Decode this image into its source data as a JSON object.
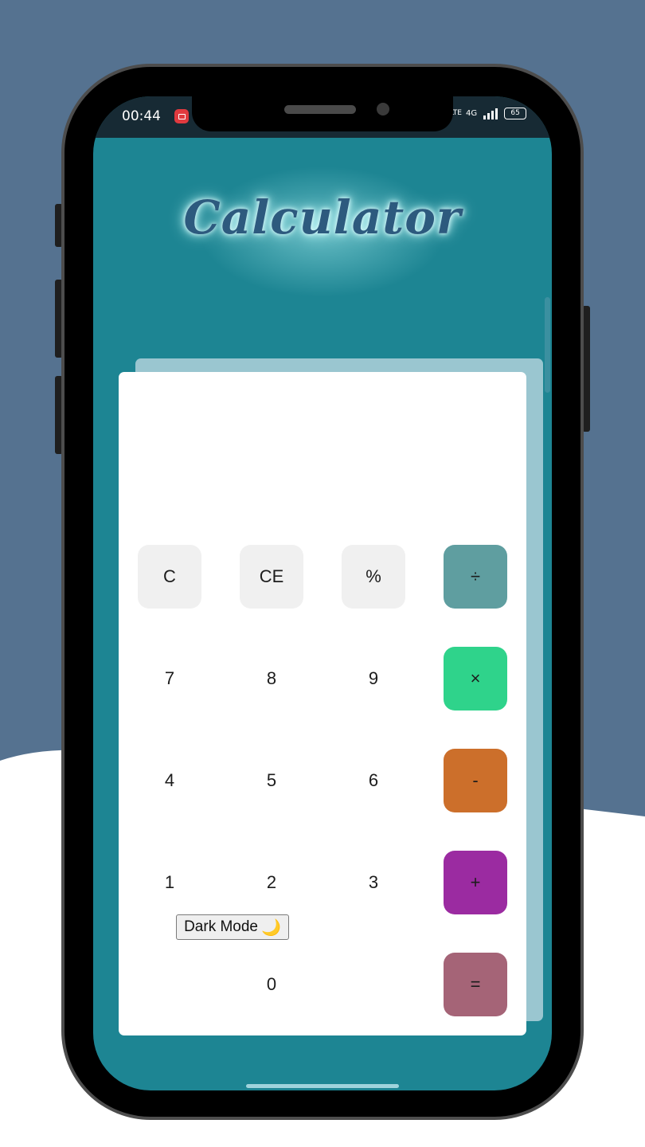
{
  "status_bar": {
    "time": "00:44",
    "network": "4G",
    "lte": "LTE",
    "battery": "65"
  },
  "app": {
    "title": "Calculator",
    "display_value": ""
  },
  "buttons": {
    "clear": "C",
    "clear_entry": "CE",
    "percent": "%",
    "divide": "÷",
    "seven": "7",
    "eight": "8",
    "nine": "9",
    "multiply": "×",
    "four": "4",
    "five": "5",
    "six": "6",
    "minus": "-",
    "one": "1",
    "two": "2",
    "three": "3",
    "plus": "+",
    "zero": "0",
    "equals": "="
  },
  "toggle": {
    "label": "Dark Mode",
    "icon": "🌙"
  },
  "colors": {
    "background": "#557290",
    "screen": "#1d8593",
    "title": "#2d5a7e",
    "divide": "#5f9ea0",
    "multiply": "#2fd38b",
    "minus": "#cc6f2b",
    "plus": "#9b2ba1",
    "equals": "#a56477"
  }
}
